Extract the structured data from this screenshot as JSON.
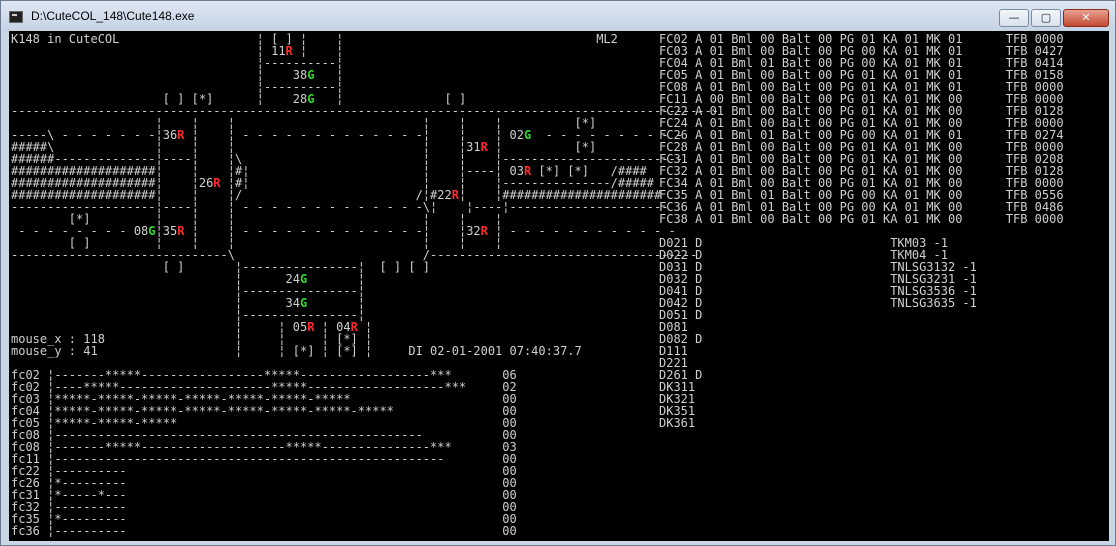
{
  "window": {
    "title": "D:\\CuteCOL_148\\Cute148.exe",
    "buttons": {
      "minimize": "—",
      "maximize": "▢",
      "close": "✕"
    }
  },
  "console": {
    "main_lines": [
      "K148 in CuteCOL                   ¦ [ ] ¦    ¦                                   ML2",
      "                                  ¦ 11R ¦    ¦",
      "                                  ¦----------¦",
      "                                  ¦    38G   ¦",
      "                                  ¦----------¦",
      "                     [ ] [*]      ¦    28G   ¦              [ ]",
      "--------------------------------------------------------------------------------------------------",
      "                    ¦    ¦    ¦                          ¦    ¦    ¦          [*]",
      "-----\\ - - - - - - -¦36R ¦    ¦ - - - - - - - - - - - - -¦    ¦    ¦ 02G  - - - - - - - - - -",
      "#####\\              ¦    ¦    ¦                          ¦    ¦31R ¦          [*]",
      "######--------------¦----¦    ¦\\                         ¦    ¦    ¦-------------------------",
      "####################¦    ¦    ¦#¦                        ¦    ¦----¦ 03R [*] [*]   /####",
      "####################¦    ¦26R ¦#¦                        ¦    ¦    ¦---------------/#####",
      "####################¦    ¦    ¦/                        /¦#22R¦    ¦######################",
      "--------------------¦----¦    ¦ - - - - - - - - - - - - -\\¦    ¦----¦----------------------",
      "        [*]         ¦    ¦    ¦                          ¦    ¦    ¦",
      " - - - - - - - - 08G¦35R ¦    ¦ - - - - - - - - - - - - -¦    ¦32R ¦ - - - - - - - - - - - -",
      "        [ ]         ¦    ¦    ¦                          ¦    ¦    ¦",
      "------------------------------\\                          /-------------------------------------",
      "                     [ ]       ¦----------------¦  [ ] [ ]",
      "                               ¦      24G       ¦",
      "                               ¦----------------¦",
      "                               ¦      34G       ¦",
      "                               ¦----------------¦",
      "                               ¦     ¦ 05R ¦ 04R ¦",
      "mouse_x : 118                  ¦     ¦     ¦ [*] ¦",
      "mouse_y : 41                   ¦     ¦ [*] ¦ [*] ¦     DI 02-01-2001 07:40:37.7"
    ],
    "status_lines": [
      "FC02 A 01 Bml 00 Balt 00 PG 01 KA 01 MK 01      TFB 0000",
      "FC03 A 01 Bml 00 Balt 00 PG 00 KA 01 MK 01      TFB 0427",
      "FC04 A 01 Bml 01 Balt 00 PG 00 KA 01 MK 01      TFB 0414",
      "FC05 A 01 Bml 00 Balt 00 PG 01 KA 01 MK 01      TFB 0158",
      "FC08 A 01 Bml 00 Balt 00 PG 01 KA 01 MK 01      TFB 0000",
      "FC11 A 00 Bml 00 Balt 00 PG 01 KA 01 MK 00      TFB 0000",
      "FC22 A 01 Bml 00 Balt 00 PG 01 KA 01 MK 00      TFB 0128",
      "FC24 A 01 Bml 00 Balt 00 PG 01 KA 01 MK 00      TFB 0000",
      "FC26 A 01 Bml 01 Balt 00 PG 00 KA 01 MK 01      TFB 0274",
      "FC28 A 01 Bml 00 Balt 00 PG 01 KA 01 MK 00      TFB 0000",
      "FC31 A 01 Bml 00 Balt 00 PG 01 KA 01 MK 00      TFB 0208",
      "FC32 A 01 Bml 00 Balt 00 PG 01 KA 01 MK 00      TFB 0128",
      "FC34 A 01 Bml 00 Balt 00 PG 01 KA 01 MK 00      TFB 0000",
      "FC35 A 01 Bml 01 Balt 00 PG 00 KA 01 MK 00      TFB 0556",
      "FC36 A 01 Bml 01 Balt 00 PG 00 KA 01 MK 00      TFB 0486",
      "FC38 A 01 Bml 00 Balt 00 PG 01 KA 01 MK 00      TFB 0000",
      "",
      "D021 D                          TKM03 -1",
      "D022 D                          TKM04 -1",
      "D031 D                          TNLSG3132 -1",
      "D032 D                          TNLSG3231 -1",
      "D041 D                          TNLSG3536 -1",
      "D042 D                          TNLSG3635 -1",
      "D051 D",
      "D081",
      "D082 D",
      "D111",
      "D221",
      "D261 D",
      "DK311",
      "DK321",
      "DK351",
      "DK361"
    ],
    "plot_lines": [
      "fc02 ¦-------*****-----------------*****------------------***       06",
      "fc02 ¦----*****---------------------*****-------------------***     02",
      "fc03 ¦*****-*****-*****-*****-*****-*****-*****                     00",
      "fc04 ¦*****-*****-*****-*****-*****-*****-*****-*****               00",
      "fc05 ¦*****-*****-*****                                             00",
      "fc08 ¦---------------------------------------------------           00",
      "fc08 ¦-------*****--------------------*****---------------***       03",
      "fc11 ¦------------------------------------------------------        00",
      "fc22 ¦----------                                                    00",
      "fc26 ¦*---------                                                    00",
      "fc31 ¦*-----*---                                                    00",
      "fc32 ¦----------                                                    00",
      "fc35 ¦*---------                                                    00",
      "fc36 ¦----------                                                    00"
    ]
  },
  "colors": {
    "text": "#d0d0d0",
    "red": "#ff2a2a",
    "green": "#2bd82b",
    "background": "#000000"
  }
}
